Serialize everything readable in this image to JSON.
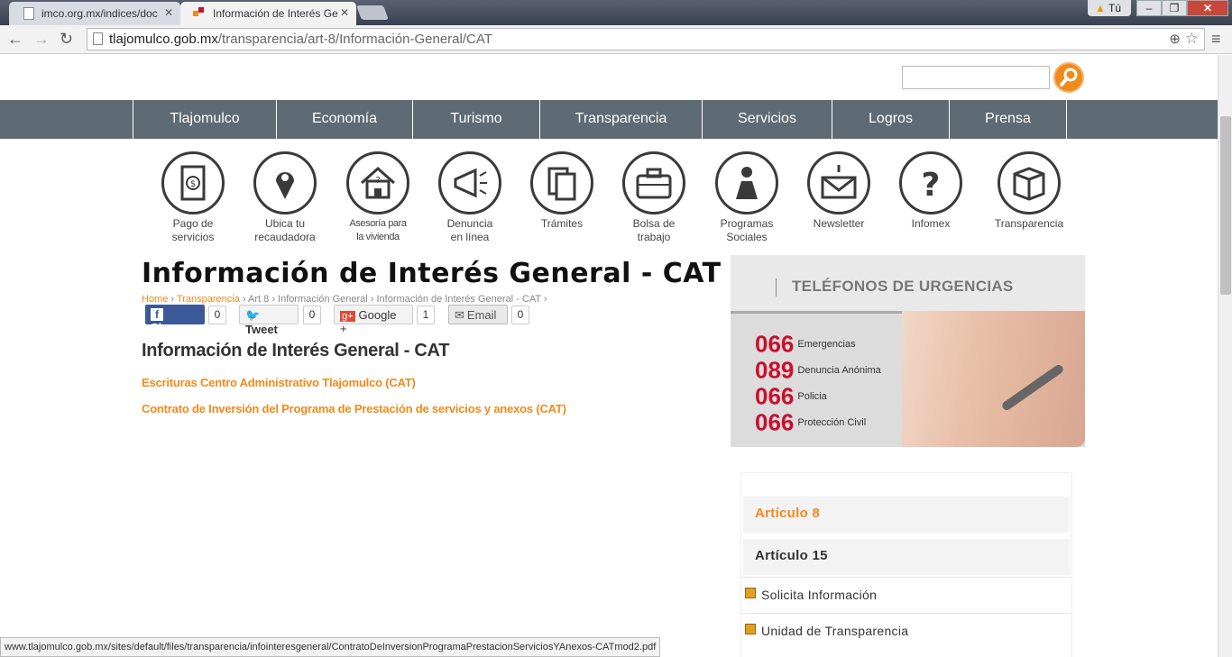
{
  "browser": {
    "tabs": [
      {
        "label": "imco.org.mx/indices/doc"
      },
      {
        "label": "Información de Interés Ge"
      }
    ],
    "user_label": "Tú",
    "url_host": "tlajomulco.gob.mx",
    "url_path": "/transparencia/art-8/Información-General/CAT",
    "status_url": "www.tlajomulco.gob.mx/sites/default/files/transparencia/infointeresgeneral/ContratoDeInversionProgramaPrestacionServiciosYAnexos-CATmod2.pdf"
  },
  "nav": {
    "items": [
      "Tlajomulco",
      "Economía",
      "Turismo",
      "Transparencia",
      "Servicios",
      "Logros",
      "Prensa"
    ]
  },
  "services": [
    {
      "line1": "Pago de",
      "line2": "servicios",
      "icon": "payment-icon"
    },
    {
      "line1": "Ubica tu",
      "line2": "recaudadora",
      "icon": "location-pin-icon"
    },
    {
      "line1": "Asesoría para",
      "line2": "la vivienda",
      "icon": "house-question-icon"
    },
    {
      "line1": "Denuncia",
      "line2": "en línea",
      "icon": "megaphone-icon"
    },
    {
      "line1": "Trámites",
      "line2": "",
      "icon": "documents-icon"
    },
    {
      "line1": "Bolsa de",
      "line2": "trabajo",
      "icon": "briefcase-icon"
    },
    {
      "line1": "Programas",
      "line2": "Sociales",
      "icon": "person-icon"
    },
    {
      "line1": "Newsletter",
      "line2": "",
      "icon": "envelope-icon"
    },
    {
      "line1": "Infomex",
      "line2": "",
      "icon": "question-icon"
    },
    {
      "line1": "Transparencia",
      "line2": "",
      "icon": "open-box-icon"
    }
  ],
  "content": {
    "title": "Información de Interés General - CAT",
    "breadcrumb": {
      "home": "Home",
      "sep": "›",
      "transparencia": "Transparencia",
      "rest": "Art 8 › Información General › Información de Interés General - CAT ›"
    },
    "share": {
      "facebook": "Share",
      "facebook_count": "0",
      "twitter": "Tweet",
      "twitter_count": "0",
      "google": "Google +",
      "google_count": "1",
      "email": "Email",
      "email_count": "0"
    },
    "subheading": "Información de Interés General - CAT",
    "links": [
      "Escrituras Centro Administrativo Tlajomulco (CAT)",
      "Contrato de Inversión del Programa de Prestación de servicios y anexos (CAT)"
    ]
  },
  "phones": {
    "title": "TELÉFONOS DE URGENCIAS",
    "rows": [
      {
        "number": "066",
        "label": "Emergencias"
      },
      {
        "number": "089",
        "label": "Denuncia Anónima"
      },
      {
        "number": "066",
        "label": "Policia"
      },
      {
        "number": "066",
        "label": "Protección Civil"
      }
    ]
  },
  "sidemenu": {
    "art8": "Artículo 8",
    "art15": "Artículo 15",
    "solicita": "Solicita Información",
    "unidad": "Unidad de Transparencia"
  },
  "colors": {
    "accent": "#f08a1c",
    "nav": "#5f6b74",
    "phone_red": "#c8102e"
  }
}
